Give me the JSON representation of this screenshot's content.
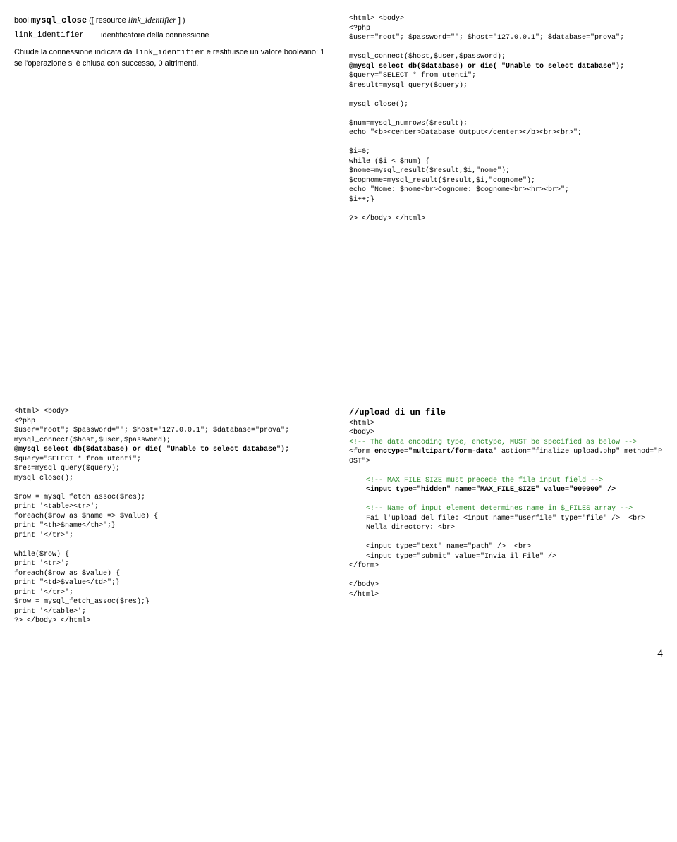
{
  "left1": {
    "sig_prefix": "bool ",
    "sig_func": "mysql_close",
    "sig_paren_open": " ([ resource ",
    "sig_arg": "link_identifier",
    "sig_close": " ] )",
    "param_name": "link_identifier",
    "param_desc": "identificatore della connessione",
    "desc_a": "Chiude la connessione indicata da ",
    "desc_code": "link_identifier",
    "desc_b": " e restituisce un valore booleano: 1 se l'operazione si è chiusa con successo, 0 altrimenti."
  },
  "right1_pre": "<html> <body>\n<?php\n$user=\"root\"; $password=\"\"; $host=\"127.0.0.1\"; $database=\"prova\";\n\nmysql_connect($host,$user,$password);",
  "right1_bold": "@mysql_select_db($database) or die( \"Unable to select database\");",
  "right1_post": "\n$query=\"SELECT * from utenti\";\n$result=mysql_query($query);\n\nmysql_close();\n\n$num=mysql_numrows($result);\necho \"<b><center>Database Output</center></b><br><br>\";\n\n$i=0;\nwhile ($i < $num) {\n$nome=mysql_result($result,$i,\"nome\");\n$cognome=mysql_result($result,$i,\"cognome\");\necho \"Nome: $nome<br>Cognome: $cognome<br><hr><br>\";\n$i++;}\n\n?> </body> </html>",
  "left2_pre": "<html> <body>\n<?php\n$user=\"root\"; $password=\"\"; $host=\"127.0.0.1\"; $database=\"prova\";\nmysql_connect($host,$user,$password);",
  "left2_bold": "@mysql_select_db($database) or die( \"Unable to select database\");",
  "left2_post": "$query=\"SELECT * from utenti\";\n$res=mysql_query($query);\nmysql_close();\n\n$row = mysql_fetch_assoc($res);\nprint '<table><tr>';\nforeach($row as $name => $value) {\nprint \"<th>$name</th>\";}\nprint '</tr>';\n\nwhile($row) {\nprint '<tr>';\nforeach($row as $value) {\nprint \"<td>$value</td>\";}\nprint '</tr>';\n$row = mysql_fetch_assoc($res);}\nprint '</table>';\n?> </body> </html>",
  "right2_title": "//upload di un file",
  "right2_l1": "<html>\n<body>\n",
  "right2_c1": "<!-- The data encoding type, enctype, MUST be specified as below -->",
  "right2_l2": "\n<form ",
  "right2_b1": "enctype=\"multipart/form-data\"",
  "right2_l3": " action=\"finalize_upload.php\" method=\"POST\">\n\n    ",
  "right2_c2": "<!-- MAX_FILE_SIZE must precede the file input field -->",
  "right2_l4": "\n    ",
  "right2_b2": "<input type=\"hidden\" name=\"MAX_FILE_SIZE\" value=\"900000\" />",
  "right2_l5": "\n\n    ",
  "right2_c3": "<!-- Name of input element determines name in $_FILES array -->",
  "right2_l6": "\n    Fai l'upload del file: <input name=\"userfile\" type=\"file\" />  <br>\n    Nella directory: <br>\n\n    <input type=\"text\" name=\"path\" />  <br>\n    <input type=\"submit\" value=\"Invia il File\" />\n</form>\n\n</body>\n</html>",
  "page": "4"
}
